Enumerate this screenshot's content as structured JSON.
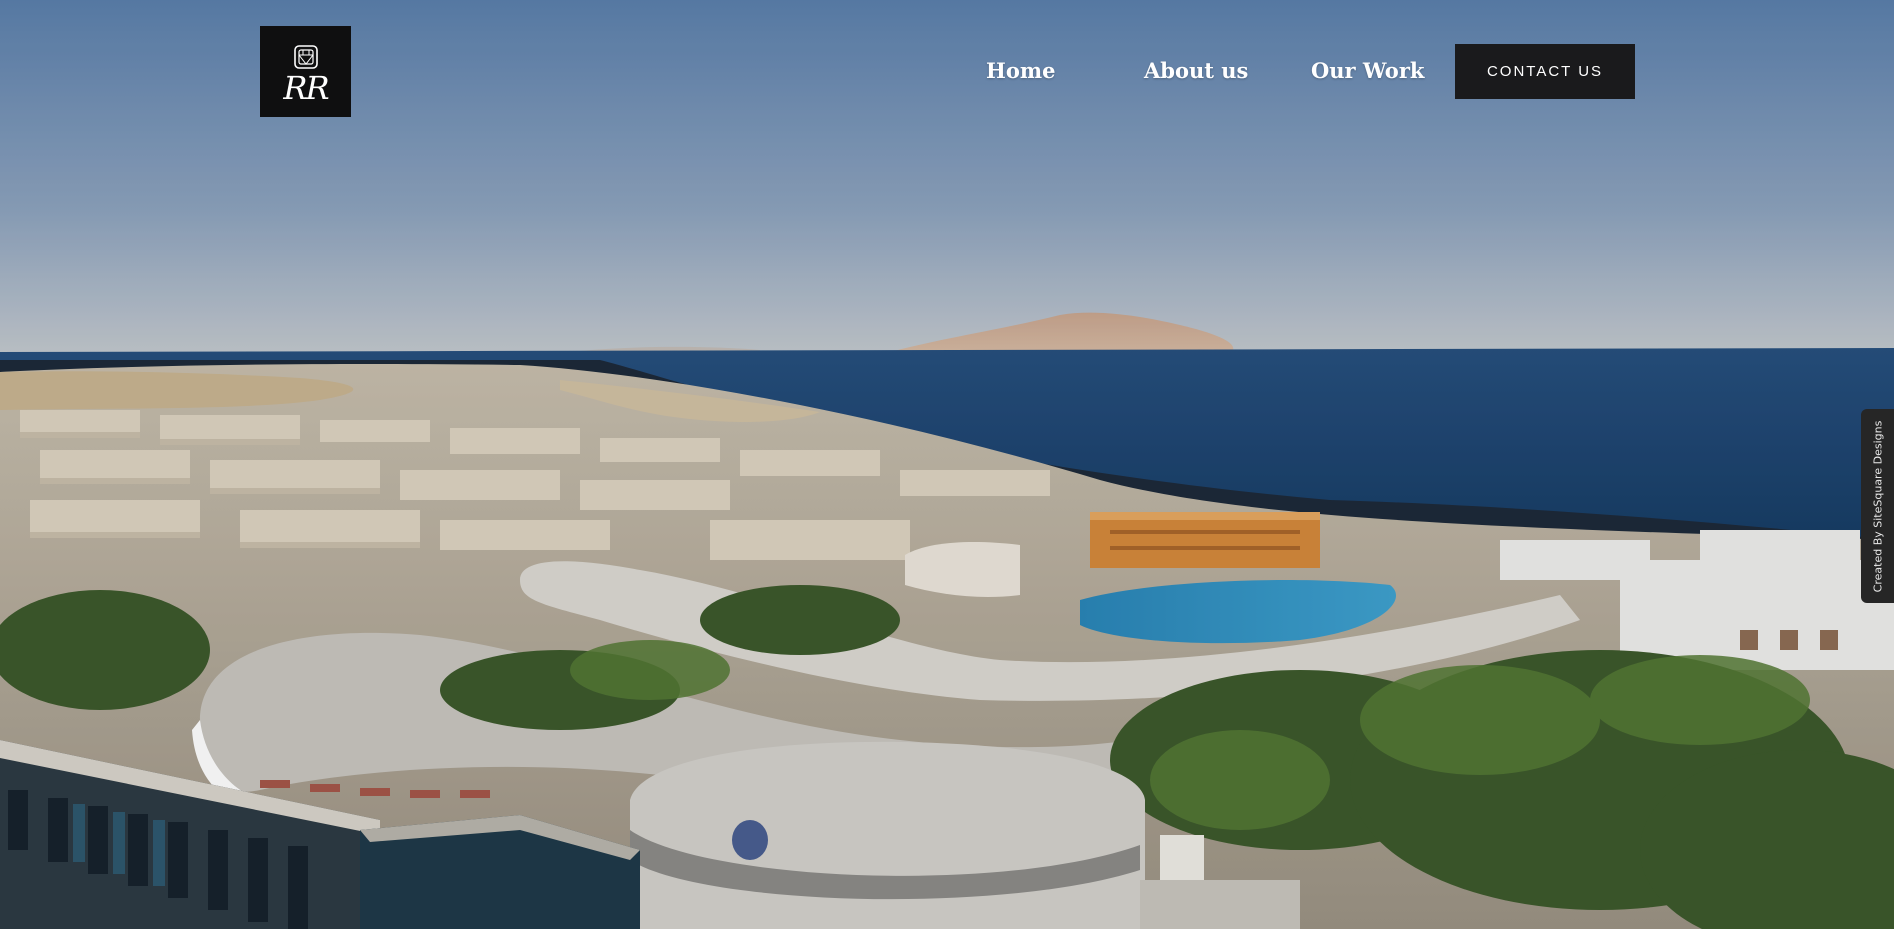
{
  "logo": {
    "text": "RR",
    "icon": "diamond-icon"
  },
  "nav": {
    "items": [
      {
        "label": "Home"
      },
      {
        "label": "About us"
      },
      {
        "label": "Our Work"
      }
    ],
    "contact_label": "CONTACT US"
  },
  "credit": {
    "text": "Created By SiteSquare Designs"
  },
  "colors": {
    "sky_top": "#5e83b0",
    "sky_horizon": "#c4cdd5",
    "sea": "#1c4775",
    "button_bg": "#1a1a1c",
    "logo_bg": "#0f0f10"
  }
}
